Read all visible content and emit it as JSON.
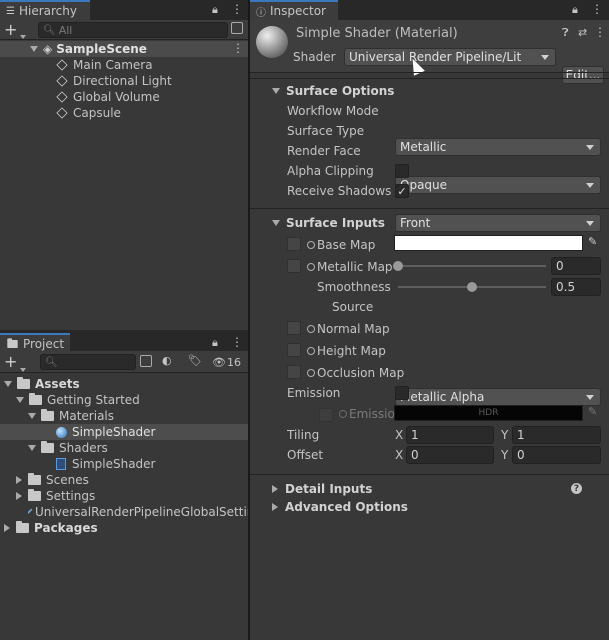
{
  "hierarchy": {
    "tab_label": "Hierarchy",
    "search_placeholder": "All",
    "scene_name": "SampleScene",
    "items": [
      "Main Camera",
      "Directional Light",
      "Global Volume",
      "Capsule"
    ]
  },
  "project": {
    "tab_label": "Project",
    "hidden_count": "16",
    "tree": {
      "assets": "Assets",
      "getting_started": "Getting Started",
      "materials": "Materials",
      "material_item": "SimpleShader",
      "shaders": "Shaders",
      "shader_item": "SimpleShader",
      "scenes": "Scenes",
      "settings": "Settings",
      "urp_settings": "UniversalRenderPipelineGlobalSettings",
      "packages": "Packages"
    }
  },
  "inspector": {
    "tab_label": "Inspector",
    "material_title": "Simple Shader (Material)",
    "shader_label": "Shader",
    "shader_value": "Universal Render Pipeline/Lit",
    "edit_label": "Edit...",
    "surface_options": {
      "header": "Surface Options",
      "workflow_mode_label": "Workflow Mode",
      "workflow_mode_value": "Metallic",
      "surface_type_label": "Surface Type",
      "surface_type_value": "Opaque",
      "render_face_label": "Render Face",
      "render_face_value": "Front",
      "alpha_clipping_label": "Alpha Clipping",
      "receive_shadows_label": "Receive Shadows",
      "receive_shadows_check": "✓"
    },
    "surface_inputs": {
      "header": "Surface Inputs",
      "base_map_label": "Base Map",
      "metallic_map_label": "Metallic Map",
      "metallic_value": "0",
      "smoothness_label": "Smoothness",
      "smoothness_value": "0.5",
      "smoothness_fraction": 0.5,
      "source_label": "Source",
      "source_value": "Metallic Alpha",
      "normal_map_label": "Normal Map",
      "height_map_label": "Height Map",
      "occlusion_map_label": "Occlusion Map",
      "emission_label": "Emission",
      "emission_map_label": "Emission",
      "hdr_label": "HDR",
      "tiling_label": "Tiling",
      "tiling_x_label": "X",
      "tiling_x": "1",
      "tiling_y_label": "Y",
      "tiling_y": "1",
      "offset_label": "Offset",
      "offset_x_label": "X",
      "offset_x": "0",
      "offset_y_label": "Y",
      "offset_y": "0"
    },
    "detail_inputs": "Detail Inputs",
    "advanced_options": "Advanced Options"
  },
  "colors": {
    "accent": "#3a79bb",
    "selection": "#4d4d4d",
    "panel": "#383838"
  }
}
